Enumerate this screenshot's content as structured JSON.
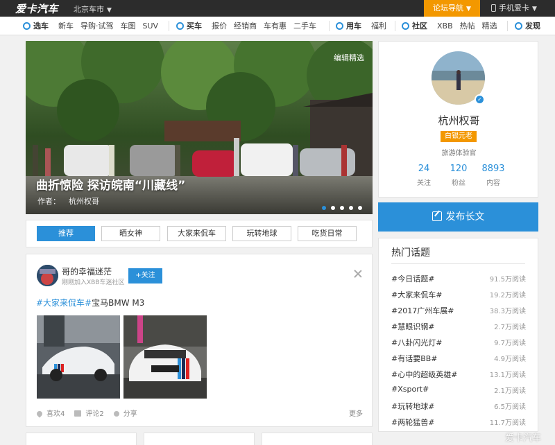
{
  "topbar": {
    "logo": "爱卡汽车",
    "city": "北京车市",
    "forum_nav": "论坛导航",
    "mobile": "手机爱卡"
  },
  "nav": {
    "groups": [
      {
        "title": "选车",
        "items": [
          "新车",
          "导购·试驾",
          "车图",
          "SUV"
        ]
      },
      {
        "title": "买车",
        "items": [
          "报价",
          "经销商",
          "车有惠",
          "二手车"
        ]
      },
      {
        "title": "用车",
        "items": [
          "福利"
        ]
      },
      {
        "title": "社区",
        "items": [
          "XBB",
          "热帖",
          "精选"
        ]
      },
      {
        "title": "发现",
        "items": []
      }
    ]
  },
  "hero": {
    "tag": "编辑精选",
    "title": "曲折惊险 探访皖南“川藏线”",
    "author_label": "作者：",
    "author_name": "杭州权哥",
    "dots": 5,
    "active_dot": 0
  },
  "profile": {
    "name": "杭州权哥",
    "badge": "白银元老",
    "role": "旅游体验官",
    "stats": [
      {
        "value": "24",
        "label": "关注"
      },
      {
        "value": "120",
        "label": "粉丝"
      },
      {
        "value": "8893",
        "label": "内容"
      }
    ]
  },
  "publish": {
    "label": "发布长文"
  },
  "tabs": [
    "推荐",
    "晒女神",
    "大家来侃车",
    "玩转地球",
    "吃货日常"
  ],
  "post": {
    "user": "哥的幸福迷茫",
    "sub": "刚刚加入XBB车迷社区",
    "follow": "+关注",
    "tag": "#大家来侃车#",
    "text": "宝马BMW M3",
    "likes": "喜欢4",
    "comments": "评论2",
    "share": "分享",
    "more": "更多"
  },
  "hot": {
    "title": "热门话题",
    "items": [
      {
        "topic": "#今日话题#",
        "reads": "91.5万阅读"
      },
      {
        "topic": "#大家来侃车#",
        "reads": "19.2万阅读"
      },
      {
        "topic": "#2017广州车展#",
        "reads": "38.3万阅读"
      },
      {
        "topic": "#慧眼识钢#",
        "reads": "2.7万阅读"
      },
      {
        "topic": "#八卦闪光灯#",
        "reads": "9.7万阅读"
      },
      {
        "topic": "#有话要BB#",
        "reads": "4.9万阅读"
      },
      {
        "topic": "#心中的超级英雄#",
        "reads": "13.1万阅读"
      },
      {
        "topic": "#Xsport#",
        "reads": "2.1万阅读"
      },
      {
        "topic": "#玩转地球#",
        "reads": "6.5万阅读"
      },
      {
        "topic": "#两轮猛兽#",
        "reads": "11.7万阅读"
      }
    ]
  },
  "watermark": "爱卡汽车",
  "colors": {
    "accent": "#2b90d9",
    "orange": "#f39800",
    "dark": "#2c2c2c"
  }
}
